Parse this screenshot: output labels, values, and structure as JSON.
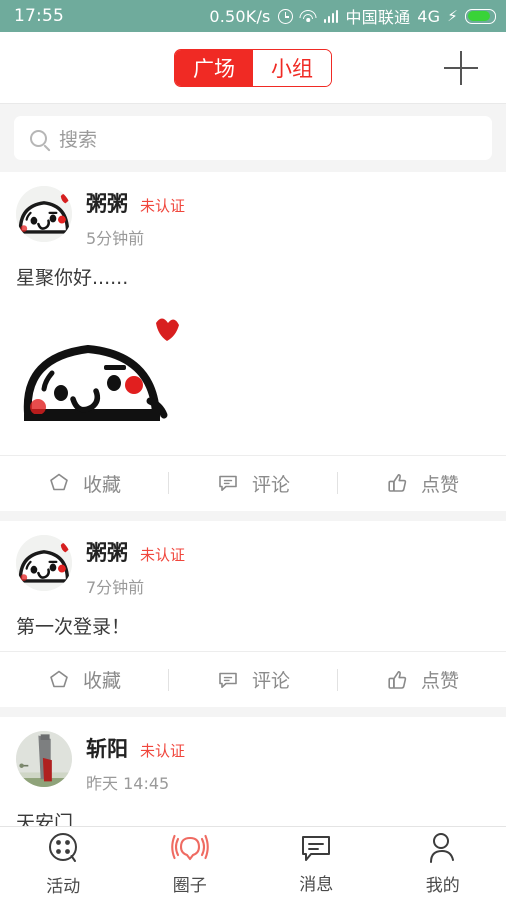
{
  "status_bar": {
    "time": "17:55",
    "net_speed": "0.50K/s",
    "carrier": "中国联通",
    "network_type": "4G",
    "icons": [
      "alarm-icon",
      "wifi-icon",
      "signal-icon",
      "charging-bolt-icon",
      "battery-icon"
    ],
    "background_color": "#6fab9c",
    "battery_color": "#39d338"
  },
  "header": {
    "tabs": [
      {
        "label": "广场",
        "active": true
      },
      {
        "label": "小组",
        "active": false
      }
    ],
    "accent_color": "#f02a24",
    "add_button": "+"
  },
  "search": {
    "placeholder": "搜索",
    "icon": "search-icon"
  },
  "actions_labels": {
    "favorite": "收藏",
    "comment": "评论",
    "like": "点赞"
  },
  "posts": [
    {
      "author": "粥粥",
      "badge": "未认证",
      "time": "5分钟前",
      "text": "星聚你好......",
      "has_image": true,
      "avatar_type": "cartoon-blob-face"
    },
    {
      "author": "粥粥",
      "badge": "未认证",
      "time": "7分钟前",
      "text": "第一次登录！",
      "has_image": false,
      "avatar_type": "cartoon-blob-face"
    },
    {
      "author": "斩阳",
      "badge": "未认证",
      "time": "昨天 14:45",
      "text": "天安门",
      "has_image": false,
      "avatar_type": "photo-monument"
    }
  ],
  "tabbar": {
    "items": [
      {
        "label": "活动",
        "icon": "activity-dots-icon",
        "active": false
      },
      {
        "label": "圈子",
        "icon": "circle-broadcast-icon",
        "active": true
      },
      {
        "label": "消息",
        "icon": "message-bubble-icon",
        "active": false
      },
      {
        "label": "我的",
        "icon": "person-icon",
        "active": false
      }
    ],
    "active_color": "#ef6b62"
  }
}
